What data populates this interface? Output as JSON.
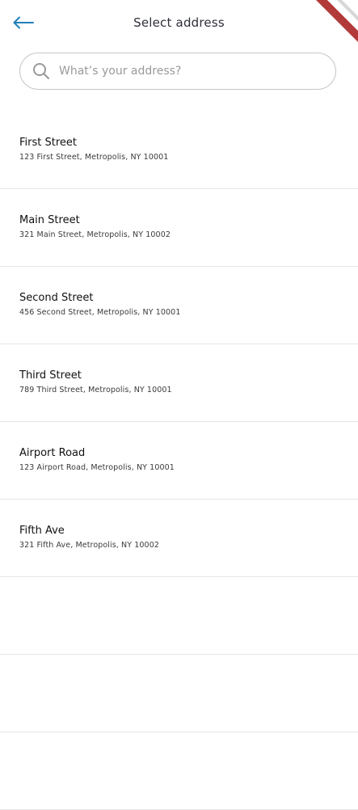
{
  "header": {
    "title": "Select address",
    "back_icon": "arrow-left-icon",
    "accent_color": "#1f7fb8"
  },
  "search": {
    "placeholder": "What’s your address?",
    "value": "",
    "icon": "search-icon"
  },
  "addresses": [
    {
      "name": "First Street",
      "detail": "123 First Street, Metropolis, NY 10001"
    },
    {
      "name": "Main Street",
      "detail": "321 Main Street, Metropolis, NY 10002"
    },
    {
      "name": "Second Street",
      "detail": "456 Second Street, Metropolis, NY 10001"
    },
    {
      "name": "Third Street",
      "detail": "789 Third Street, Metropolis, NY 10001"
    },
    {
      "name": "Airport Road",
      "detail": "123 Airport Road, Metropolis, NY 10001"
    },
    {
      "name": "Fifth Ave",
      "detail": "321 Fifth Ave, Metropolis, NY 10002"
    },
    {
      "name": "",
      "detail": ""
    },
    {
      "name": "",
      "detail": ""
    },
    {
      "name": "",
      "detail": ""
    }
  ]
}
